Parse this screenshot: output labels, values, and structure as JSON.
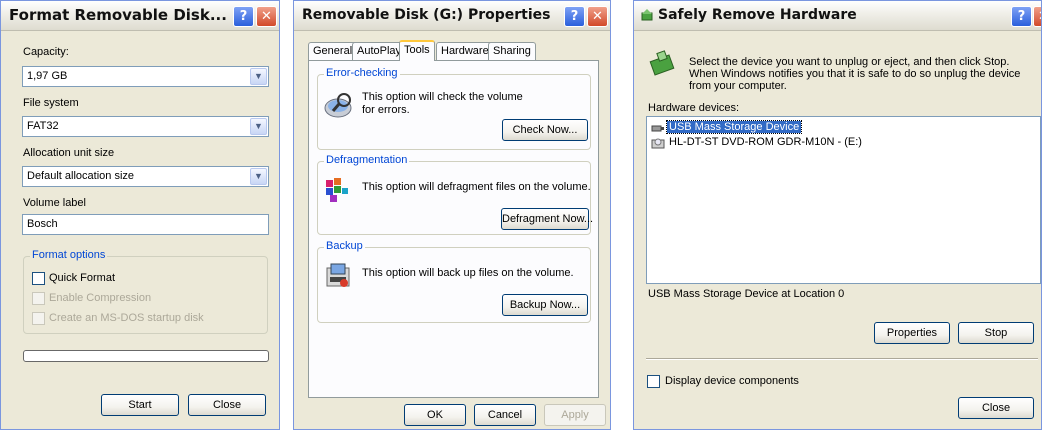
{
  "format_dialog": {
    "title": "Format Removable Disk...",
    "capacity_label": "Capacity:",
    "capacity_value": "1,97 GB",
    "filesystem_label": "File system",
    "filesystem_value": "FAT32",
    "alloc_label": "Allocation unit size",
    "alloc_value": "Default allocation size",
    "volume_label": "Volume label",
    "volume_value": "Bosch",
    "options_group": "Format options",
    "quick_format": "Quick Format",
    "enable_compression": "Enable Compression",
    "msdos_disk": "Create an MS-DOS startup disk",
    "progress": 0,
    "start_button": "Start",
    "close_button": "Close"
  },
  "properties_dialog": {
    "title": "Removable Disk (G:) Properties",
    "tabs": [
      "General",
      "AutoPlay",
      "Tools",
      "Hardware",
      "Sharing"
    ],
    "active_tab": "Tools",
    "error_group": "Error-checking",
    "error_text": "This option will check the volume for errors.",
    "check_button": "Check Now...",
    "defrag_group": "Defragmentation",
    "defrag_text": "This option will defragment files on the volume.",
    "defrag_button": "Defragment Now...",
    "backup_group": "Backup",
    "backup_text": "This option will back up files on the volume.",
    "backup_button": "Backup Now...",
    "ok_button": "OK",
    "cancel_button": "Cancel",
    "apply_button": "Apply"
  },
  "safely_remove_dialog": {
    "title": "Safely Remove Hardware",
    "instructions": "Select the device you want to unplug or eject, and then click Stop. When Windows notifies you that it is safe to do so unplug the device from your computer.",
    "devices_label": "Hardware devices:",
    "devices": [
      "USB Mass Storage Device",
      "HL-DT-ST DVD-ROM GDR-M10N - (E:)"
    ],
    "selected_device": "USB Mass Storage Device",
    "location_text": "USB Mass Storage Device at Location 0",
    "properties_button": "Properties",
    "stop_button": "Stop",
    "display_components": "Display device components",
    "close_button": "Close"
  },
  "colors": {
    "dialog_bg": "#ece9d8",
    "group_label": "#0046d5",
    "selection": "#316ac5"
  },
  "icons": [
    "help-icon",
    "close-icon",
    "dropdown-arrow-icon",
    "error-check-icon",
    "defrag-icon",
    "backup-icon",
    "safely-remove-icon",
    "usb-icon",
    "dvd-drive-icon"
  ]
}
